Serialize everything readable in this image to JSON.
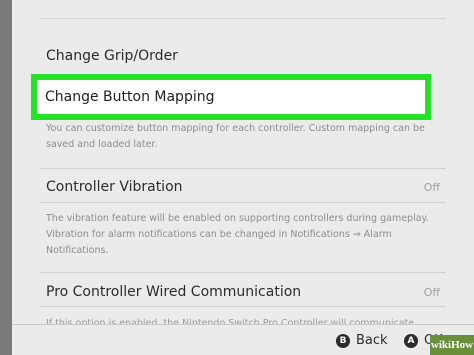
{
  "menu": {
    "change_grip": "Change Grip/Order",
    "change_mapping": "Change Button Mapping",
    "mapping_desc": "You can customize button mapping for each controller. Custom mapping can be saved and loaded later.",
    "vibration": {
      "label": "Controller Vibration",
      "value": "Off"
    },
    "vibration_desc": "The vibration feature will be enabled on supporting controllers during gameplay. Vibration for alarm notifications can be changed in Notifications ⇒ Alarm Notifications.",
    "pro_wired": {
      "label": "Pro Controller Wired Communication",
      "value": "Off"
    },
    "pro_desc": "If this option is enabled, the Nintendo Switch Pro Controller will communicate"
  },
  "footer": {
    "back_glyph": "B",
    "back_label": "Back",
    "ok_glyph": "A",
    "ok_label": "OK"
  },
  "watermark": "wikiHow",
  "colors": {
    "highlight": "#26e22a",
    "screen_bg": "#ebebeb"
  }
}
